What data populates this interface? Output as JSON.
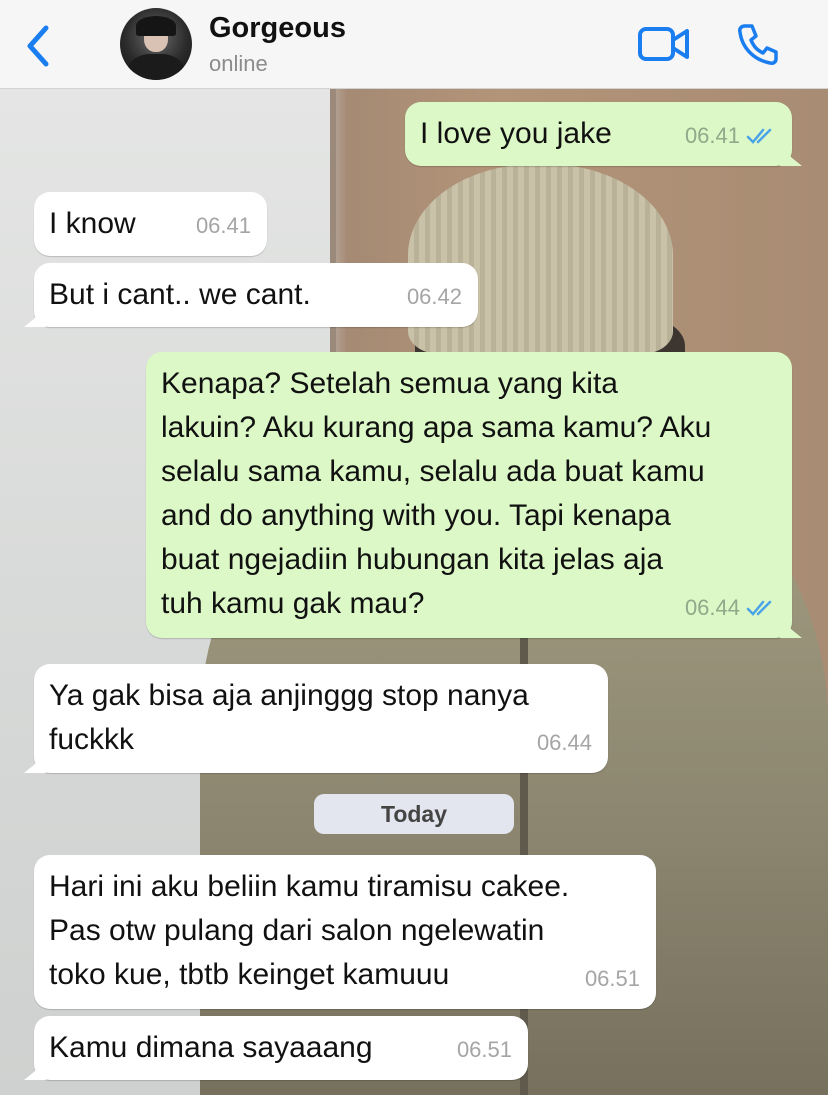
{
  "header": {
    "contact_name": "Gorgeous",
    "status": "online"
  },
  "icons": {
    "back": "chevron-left-icon",
    "video": "video-camera-icon",
    "call": "phone-icon",
    "read_receipt": "double-check-icon"
  },
  "colors": {
    "accent": "#1a7df0",
    "outgoing_bubble": "#dcf8c6",
    "incoming_bubble": "#ffffff",
    "read_ticks": "#4aa3e8"
  },
  "messages": [
    {
      "direction": "out",
      "text": "I love you jake",
      "time": "06.41",
      "read": true
    },
    {
      "direction": "in",
      "text": "I know",
      "time": "06.41"
    },
    {
      "direction": "in",
      "text": "But i cant.. we cant.",
      "time": "06.42"
    },
    {
      "direction": "out",
      "text": "Kenapa? Setelah semua yang kita\nlakuin? Aku kurang apa sama kamu? Aku\nselalu sama kamu, selalu ada buat kamu\nand do anything with you. Tapi kenapa\nbuat ngejadiin hubungan kita jelas aja\ntuh kamu gak mau?",
      "time": "06.44",
      "read": true
    },
    {
      "direction": "in",
      "text": "Ya gak bisa aja anjinggg stop nanya\nfuckkk",
      "time": "06.44"
    },
    {
      "direction": "in",
      "text": "Hari ini aku beliin kamu tiramisu cakee.\nPas otw pulang dari salon ngelewatin\ntoko kue, tbtb keinget kamuuu",
      "time": "06.51"
    },
    {
      "direction": "in",
      "text": "Kamu dimana sayaaang",
      "time": "06.51"
    }
  ],
  "date_separator": "Today"
}
